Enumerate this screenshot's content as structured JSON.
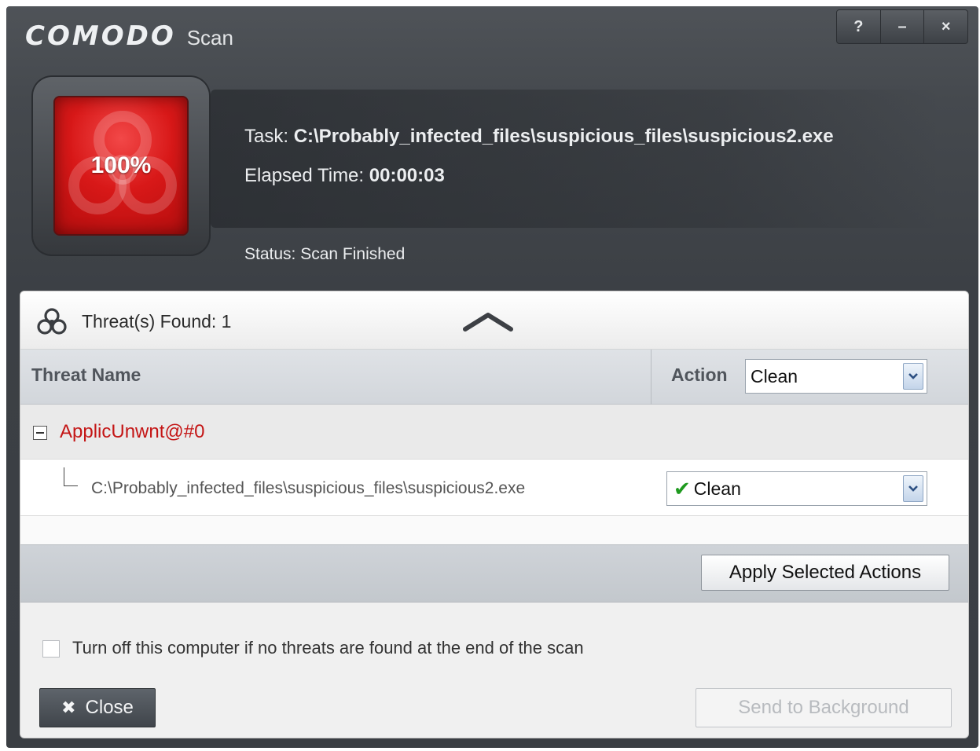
{
  "window": {
    "brand": "COMODO",
    "subtitle": "Scan",
    "controls": {
      "help": "?",
      "minimize": "–",
      "close": "×"
    }
  },
  "progress": {
    "percent_label": "100%",
    "percent": 100,
    "color": "#d81818"
  },
  "info": {
    "task_label": "Task:",
    "task_value": "C:\\Probably_infected_files\\suspicious_files\\suspicious2.exe",
    "elapsed_label": "Elapsed Time:",
    "elapsed_value": "00:00:03",
    "status_label": "Status:",
    "status_value": "Scan Finished"
  },
  "threats": {
    "found_label": "Threat(s) Found: 1",
    "columns": {
      "name": "Threat Name",
      "action": "Action"
    },
    "action_select": "Clean",
    "groups": [
      {
        "name": "ApplicUnwnt@#0",
        "files": [
          {
            "path": "C:\\Probably_infected_files\\suspicious_files\\suspicious2.exe",
            "action": "Clean"
          }
        ]
      }
    ]
  },
  "buttons": {
    "apply": "Apply Selected Actions",
    "close": "Close",
    "background": "Send to Background"
  },
  "shutdown_option": {
    "label": "Turn off this computer if no threats are found at the end of the scan",
    "checked": false
  }
}
